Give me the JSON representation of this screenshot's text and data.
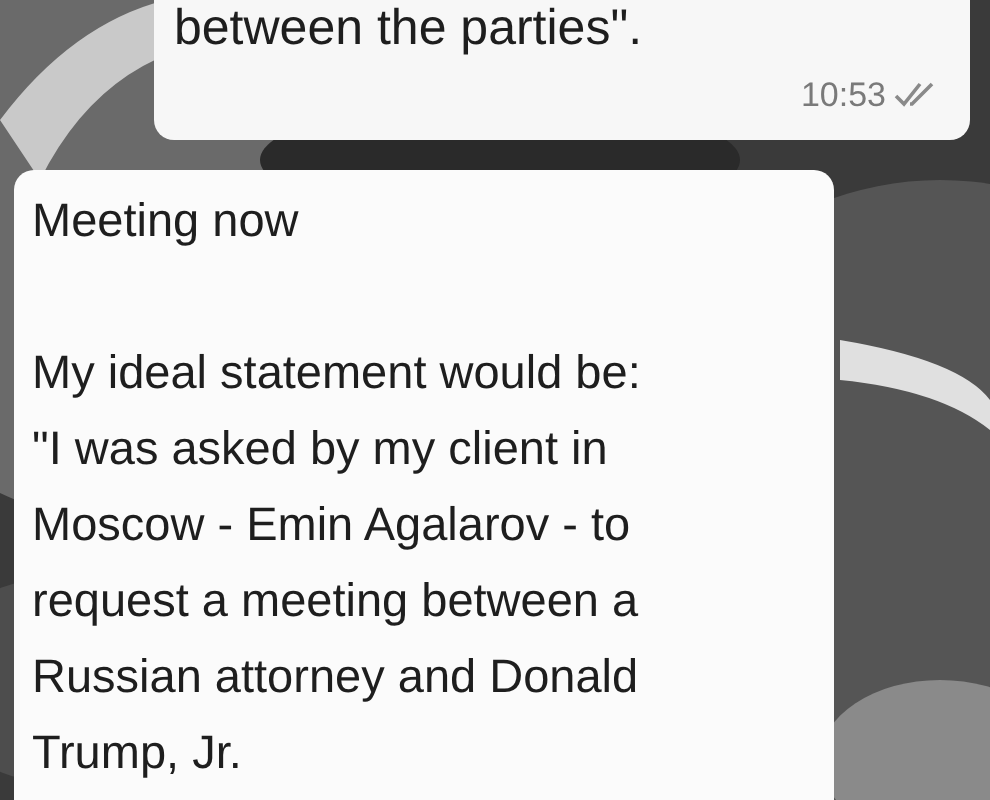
{
  "messages": [
    {
      "kind": "outgoing",
      "text": "between the parties\".",
      "time": "10:53",
      "read": true
    },
    {
      "kind": "incoming",
      "text": "Meeting now\n\nMy ideal statement would be:\n\"I was asked by my client in\nMoscow - Emin Agalarov - to\nrequest a meeting between a\nRussian attorney and Donald\nTrump, Jr."
    }
  ]
}
